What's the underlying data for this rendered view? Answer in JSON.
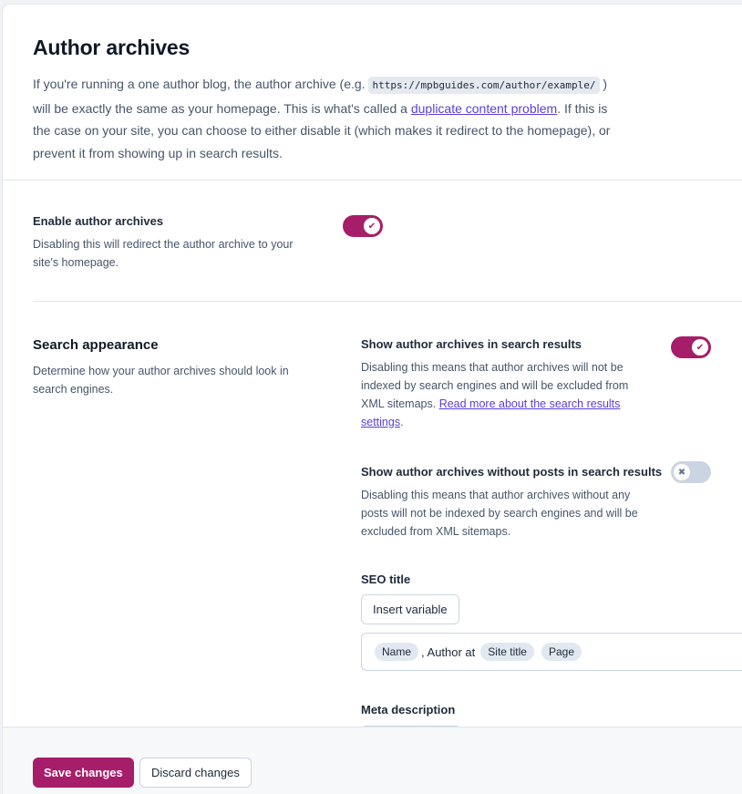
{
  "header": {
    "title": "Author archives",
    "intro_part1": "If you're running a one author blog, the author archive (e.g. ",
    "example_url": "https://mpbguides.com/author/example/",
    "intro_part2": " ) will be exactly the same as your homepage. This is what's called a ",
    "duplicate_link": "duplicate content problem",
    "intro_part3": ". If this is the case on your site, you can choose to either disable it (which makes it redirect to the homepage), or prevent it from showing up in search results."
  },
  "enable_archives": {
    "label": "Enable author archives",
    "description": "Disabling this will redirect the author archive to your site's homepage.",
    "enabled": true
  },
  "search_appearance": {
    "title": "Search appearance",
    "description": "Determine how your author archives should look in search engines.",
    "show_in_results": {
      "label": "Show author archives in search results",
      "description": "Disabling this means that author archives will not be indexed by search engines and will be excluded from XML sitemaps. ",
      "link_text": "Read more about the search results settings",
      "after_link": ".",
      "enabled": true
    },
    "show_without_posts": {
      "label": "Show author archives without posts in search results",
      "description": "Disabling this means that author archives without any posts will not be indexed by search engines and will be excluded from XML sitemaps.",
      "enabled": false
    },
    "seo_title": {
      "label": "SEO title",
      "insert_variable": "Insert variable",
      "tokens": [
        "Name",
        ", Author at",
        "Site title",
        "Page"
      ]
    },
    "meta_description": {
      "label": "Meta description"
    }
  },
  "footer": {
    "save_label": "Save changes",
    "discard_label": "Discard changes"
  },
  "colors": {
    "accent": "#a61e69",
    "link": "#5b3fd9"
  }
}
